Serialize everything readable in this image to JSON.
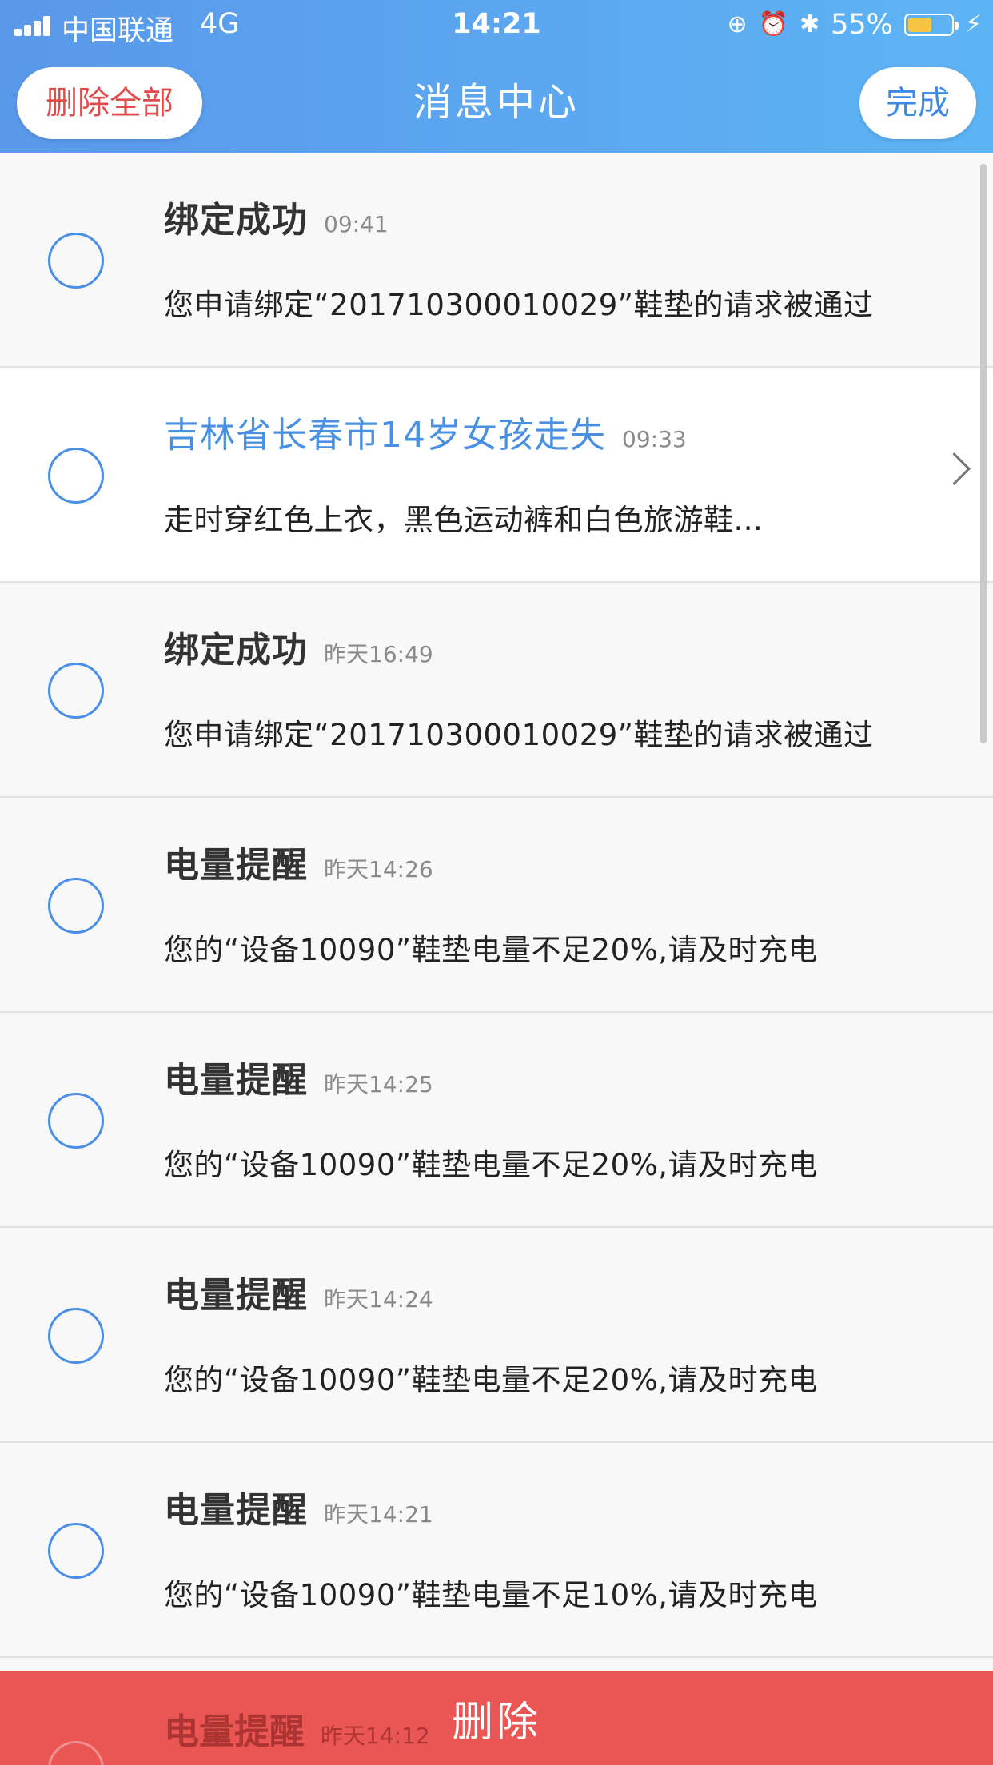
{
  "status_bar": {
    "carrier": "中国联通",
    "network": "4G",
    "time": "14:21",
    "battery_percent": "55%",
    "battery_level": 0.55,
    "icons": [
      "rotation-lock-icon",
      "alarm-icon",
      "bluetooth-icon",
      "charging-icon"
    ]
  },
  "header": {
    "delete_all_label": "删除全部",
    "title": "消息中心",
    "done_label": "完成"
  },
  "messages": [
    {
      "title": "绑定成功",
      "time": "09:41",
      "body": "您申请绑定“201710300010029”鞋垫的请求被通过"
    },
    {
      "title": "吉林省长春市14岁女孩走失",
      "time": "09:33",
      "body": "走时穿红色上衣，黑色运动裤和白色旅游鞋..."
    },
    {
      "title": "绑定成功",
      "time": "昨天16:49",
      "body": "您申请绑定“201710300010029”鞋垫的请求被通过"
    },
    {
      "title": "电量提醒",
      "time": "昨天14:26",
      "body": "您的“设备10090”鞋垫电量不足20%,请及时充电"
    },
    {
      "title": "电量提醒",
      "time": "昨天14:25",
      "body": "您的“设备10090”鞋垫电量不足20%,请及时充电"
    },
    {
      "title": "电量提醒",
      "time": "昨天14:24",
      "body": "您的“设备10090”鞋垫电量不足20%,请及时充电"
    },
    {
      "title": "电量提醒",
      "time": "昨天14:21",
      "body": "您的“设备10090”鞋垫电量不足10%,请及时充电"
    }
  ],
  "peek_message": {
    "title": "电量提醒",
    "time": "昨天14:12"
  },
  "delete_bar": {
    "label": "删除"
  },
  "colors": {
    "accent": "#4a8fe7",
    "danger": "#ea5653",
    "header_start": "#5a98ea",
    "header_end": "#5db4f5"
  }
}
